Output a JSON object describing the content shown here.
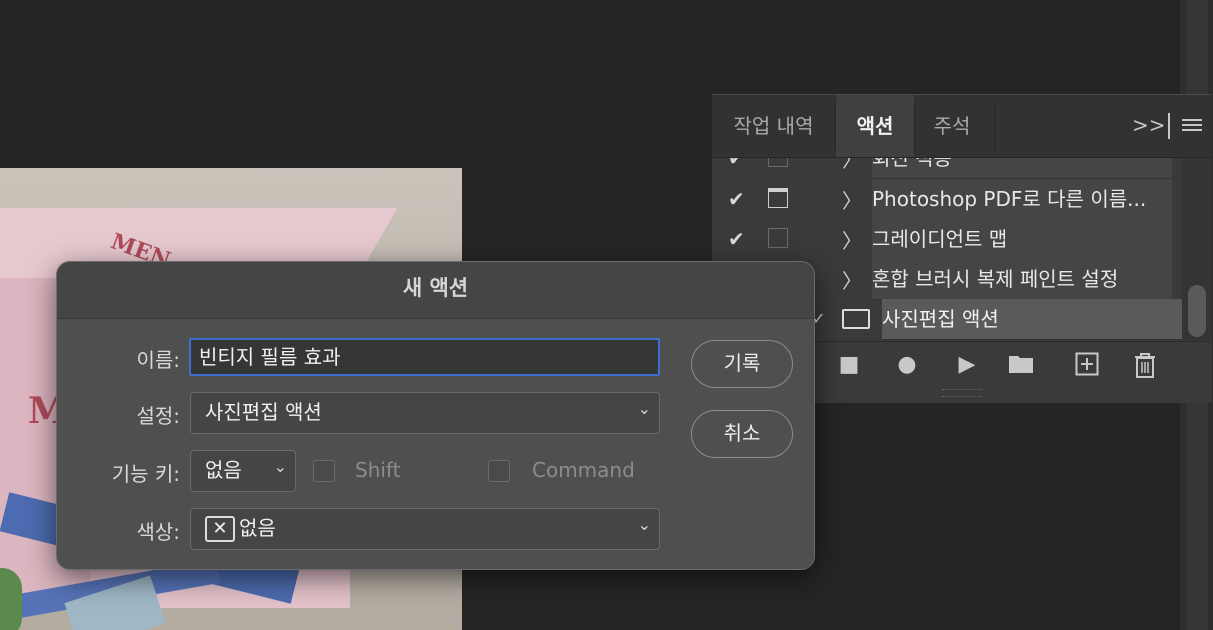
{
  "panel": {
    "tabs": [
      "작업 내역",
      "액션",
      "주석"
    ],
    "active_tab": "액션",
    "overflow_icon": ">>",
    "rows": [
      {
        "label": "회전 적용",
        "checked": true,
        "dialog": false
      },
      {
        "label": "Photoshop PDF로 다른 이름...",
        "checked": true,
        "dialog": true
      },
      {
        "label": "그레이디언트 맵",
        "checked": true,
        "dialog": false
      },
      {
        "label": "혼합 브러시 복제 페인트 설정",
        "checked": false,
        "dialog": false
      }
    ],
    "action_set": {
      "label": "사진편집 액션",
      "checked": true
    },
    "footer_icons": [
      "stop-icon",
      "record-icon",
      "play-icon",
      "folder-icon",
      "new-action-icon",
      "trash-icon"
    ]
  },
  "dialog": {
    "title": "새 액션",
    "name_label": "이름:",
    "name_value": "빈티지 필름 효과",
    "set_label": "설정:",
    "set_value": "사진편집 액션",
    "fkey_label": "기능 키:",
    "fkey_value": "없음",
    "shift_label": "Shift",
    "command_label": "Command",
    "color_label": "색상:",
    "color_value": "없음",
    "record_button": "기록",
    "cancel_button": "취소"
  },
  "photo": {
    "box_text_top": "MEN",
    "box_text_front": "M"
  }
}
